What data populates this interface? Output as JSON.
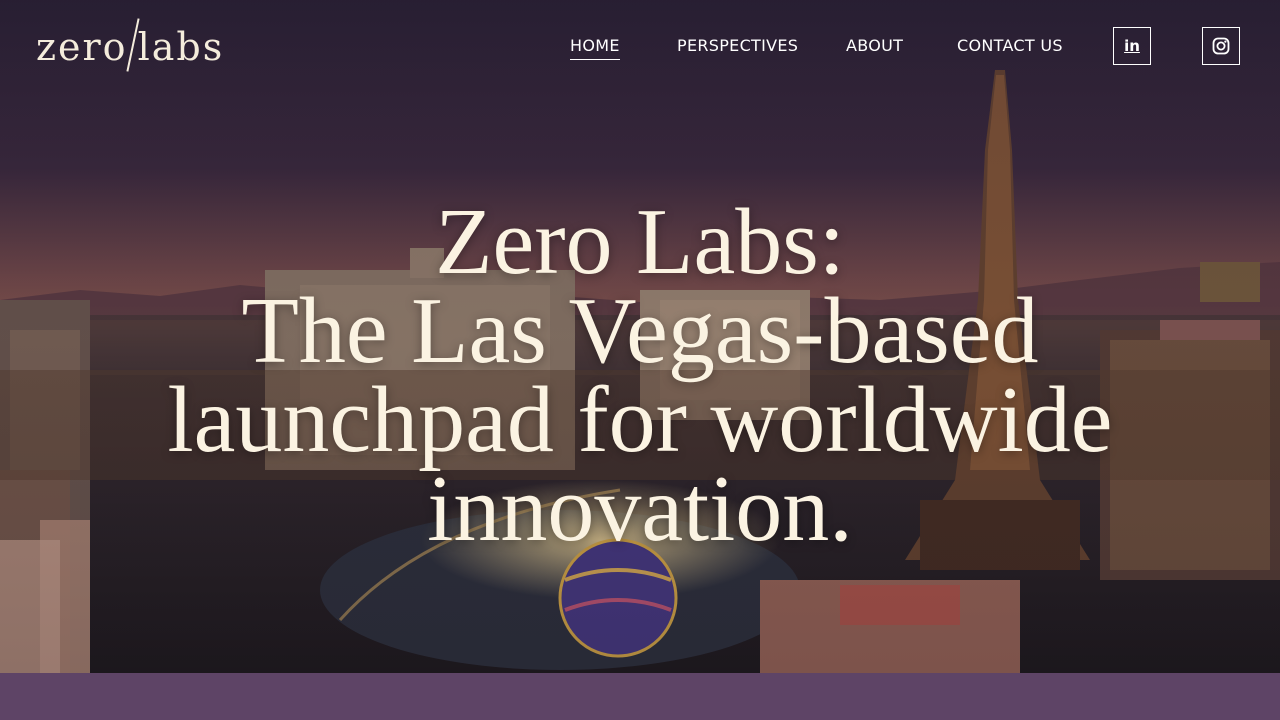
{
  "brand": {
    "logo_left": "zero",
    "logo_right": "labs"
  },
  "nav": {
    "items": [
      {
        "label": "HOME",
        "active": true
      },
      {
        "label": "PERSPECTIVES",
        "active": false
      },
      {
        "label": "ABOUT",
        "active": false
      },
      {
        "label": "CONTACT US",
        "active": false
      }
    ],
    "social": [
      {
        "icon": "linkedin-icon",
        "glyph": "in"
      },
      {
        "icon": "instagram-icon"
      }
    ]
  },
  "hero": {
    "headline_lines": [
      "Zero Labs:",
      "The Las Vegas-based",
      "launchpad for worldwide",
      "innovation."
    ],
    "background": "las-vegas-strip-night-photo"
  },
  "colors": {
    "band": "#5e4466",
    "text": "#fbf3e2",
    "nav": "#ffffff"
  }
}
